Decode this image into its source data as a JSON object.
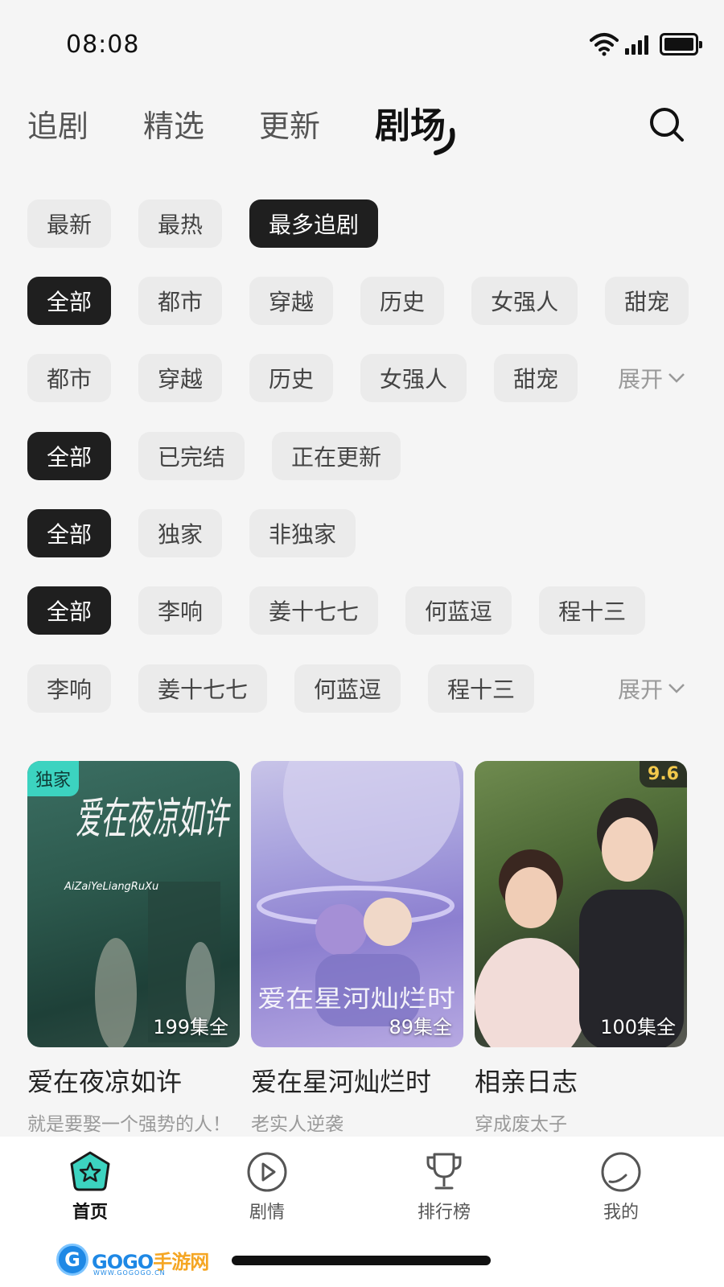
{
  "status_bar": {
    "time": "08:08"
  },
  "header": {
    "tabs": [
      {
        "label": "追剧"
      },
      {
        "label": "精选"
      },
      {
        "label": "更新"
      },
      {
        "label": "剧场"
      }
    ],
    "active_tab": "剧场"
  },
  "filters": {
    "sort": [
      "最新",
      "最热",
      "最多追剧"
    ],
    "sort_selected": "最多追剧",
    "genre_row1": [
      "全部",
      "都市",
      "穿越",
      "历史",
      "女强人",
      "甜宠"
    ],
    "genre_row2": [
      "都市",
      "穿越",
      "历史",
      "女强人",
      "甜宠"
    ],
    "status": [
      "全部",
      "已完结",
      "正在更新"
    ],
    "exclusivity": [
      "全部",
      "独家",
      "非独家"
    ],
    "actor_row1": [
      "全部",
      "李响",
      "姜十七七",
      "何蓝逗",
      "程十三"
    ],
    "actor_row2": [
      "李响",
      "姜十七七",
      "何蓝逗",
      "程十三"
    ],
    "expand_label": "展开"
  },
  "cards": [
    {
      "title": "爱在夜凉如许",
      "desc": "就是要娶一个强势的人！",
      "episodes": "199集全",
      "badge": "独家",
      "poster_text": "爱在夜凉如许",
      "poster_sub": "AiZaiYeLiangRuXu"
    },
    {
      "title": "爱在星河灿烂时",
      "desc": "老实人逆袭",
      "episodes": "89集全",
      "poster_text": "爱在星河灿烂时"
    },
    {
      "title": "相亲日志",
      "desc": "穿成废太子",
      "episodes": "100集全",
      "score": "9.6"
    }
  ],
  "bottom_nav": [
    {
      "label": "首页",
      "icon": "home-star-icon"
    },
    {
      "label": "剧情",
      "icon": "play-circle-icon"
    },
    {
      "label": "排行榜",
      "icon": "trophy-icon"
    },
    {
      "label": "我的",
      "icon": "profile-circle-icon"
    }
  ],
  "watermark": {
    "logo": "G",
    "brand_a": "GOGO",
    "brand_b": "手游网",
    "url": "WWW.GOGOGO.CN"
  },
  "colors": {
    "accent": "#3cd3c0",
    "chip_active": "#1f1f1f",
    "chip": "#ebebeb",
    "score": "#f2c94c"
  }
}
